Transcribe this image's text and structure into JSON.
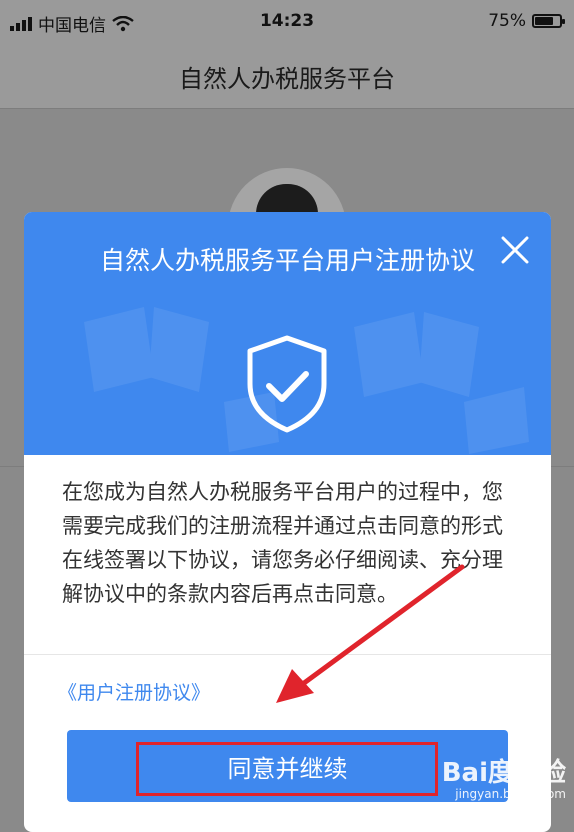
{
  "status_bar": {
    "carrier": "中国电信",
    "time": "14:23",
    "battery_level": "75%",
    "battery_fraction": 0.75
  },
  "nav": {
    "title": "自然人办税服务平台"
  },
  "modal": {
    "title": "自然人办税服务平台用户注册协议",
    "body": "在您成为自然人办税服务平台用户的过程中，您需要完成我们的注册流程并通过点击同意的形式在线签署以下协议，请您务必仔细阅读、充分理解协议中的条款内容后再点击同意。",
    "agreement_link": "《用户注册协议》",
    "agree_button": "同意并继续"
  },
  "watermark": {
    "brand": "Bai度经验",
    "url": "jingyan.baidu.com"
  },
  "colors": {
    "primary_blue": "#3f88ee",
    "annotation_red": "#e0242c"
  }
}
